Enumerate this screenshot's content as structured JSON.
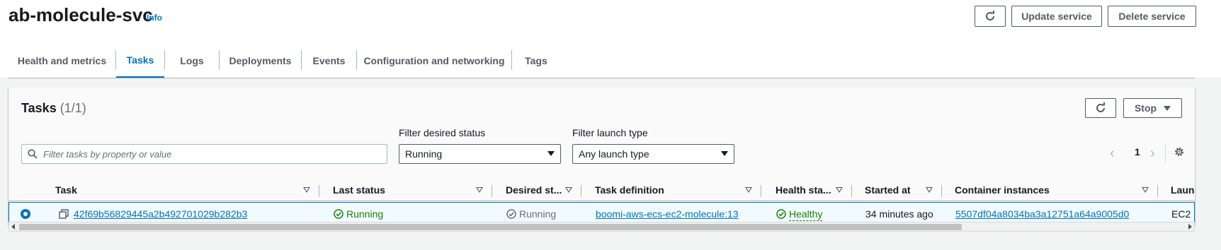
{
  "header": {
    "title": "ab-molecule-svc",
    "info_label": "Info",
    "refresh_icon": "refresh-icon",
    "update_label": "Update service",
    "delete_label": "Delete service"
  },
  "tabs": [
    {
      "label": "Health and metrics",
      "active": false
    },
    {
      "label": "Tasks",
      "active": true
    },
    {
      "label": "Logs",
      "active": false
    },
    {
      "label": "Deployments",
      "active": false
    },
    {
      "label": "Events",
      "active": false
    },
    {
      "label": "Configuration and networking",
      "active": false
    },
    {
      "label": "Tags",
      "active": false
    }
  ],
  "tasks_panel": {
    "title": "Tasks",
    "count": "(1/1)",
    "stop_label": "Stop",
    "search_placeholder": "Filter tasks by property or value",
    "filter_status_label": "Filter desired status",
    "filter_status_value": "Running",
    "filter_launch_label": "Filter launch type",
    "filter_launch_value": "Any launch type",
    "page": "1",
    "columns": [
      "Task",
      "Last status",
      "Desired st...",
      "Task definition",
      "Health sta...",
      "Started at",
      "Container instances",
      "Launch"
    ],
    "rows": [
      {
        "task": "42f69b56829445a2b492701029b282b3",
        "last_status": "Running",
        "desired_status": "Running",
        "task_definition": "boomi-aws-ecs-ec2-molecule:13",
        "health_status": "Healthy",
        "started_at": "34 minutes ago",
        "container_instance": "5507df04a8034ba3a12751a64a9005d0",
        "launch_type": "EC2"
      }
    ]
  },
  "colors": {
    "accent": "#0073bb",
    "success": "#1d8102",
    "muted": "#687078"
  }
}
